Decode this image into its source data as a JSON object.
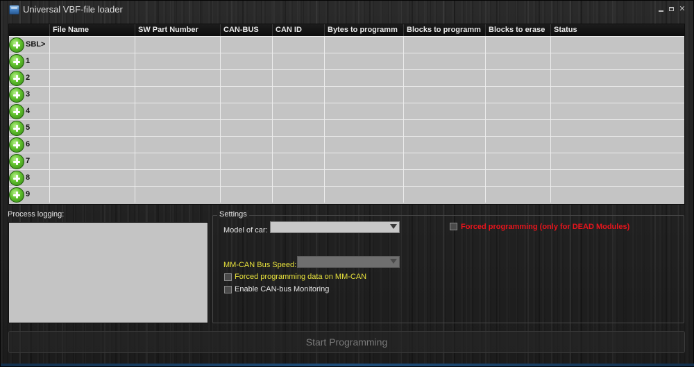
{
  "window": {
    "title": "Universal VBF-file loader"
  },
  "grid": {
    "columns": [
      "File Name",
      "SW Part Number",
      "CAN-BUS",
      "CAN ID",
      "Bytes to programm",
      "Blocks to programm",
      "Blocks to erase",
      "Status"
    ],
    "rows": [
      "SBL>",
      "1",
      "2",
      "3",
      "4",
      "5",
      "6",
      "7",
      "8",
      "9"
    ]
  },
  "log": {
    "label": "Process logging:"
  },
  "settings": {
    "legend": "Settings",
    "model_label": "Model of car:",
    "model_value": "",
    "mmcan_speed_label": "MM-CAN Bus Speed:",
    "mmcan_speed_value": "",
    "forced_mmcan_label": "Forced programming data on MM-CAN",
    "forced_mmcan_checked": false,
    "can_monitoring_label": "Enable CAN-bus Monitoring",
    "can_monitoring_checked": false,
    "forced_dead_label": "Forced programming (only for DEAD Modules)",
    "forced_dead_checked": false
  },
  "start_button": {
    "label": "Start Programming",
    "enabled": false
  },
  "colors": {
    "warning_red": "#e8141c",
    "highlight_yellow": "#e8e23c",
    "add_green": "#4caf2a"
  },
  "icons": {
    "row_add": "plus-circle-icon",
    "app": "window-app-icon"
  }
}
